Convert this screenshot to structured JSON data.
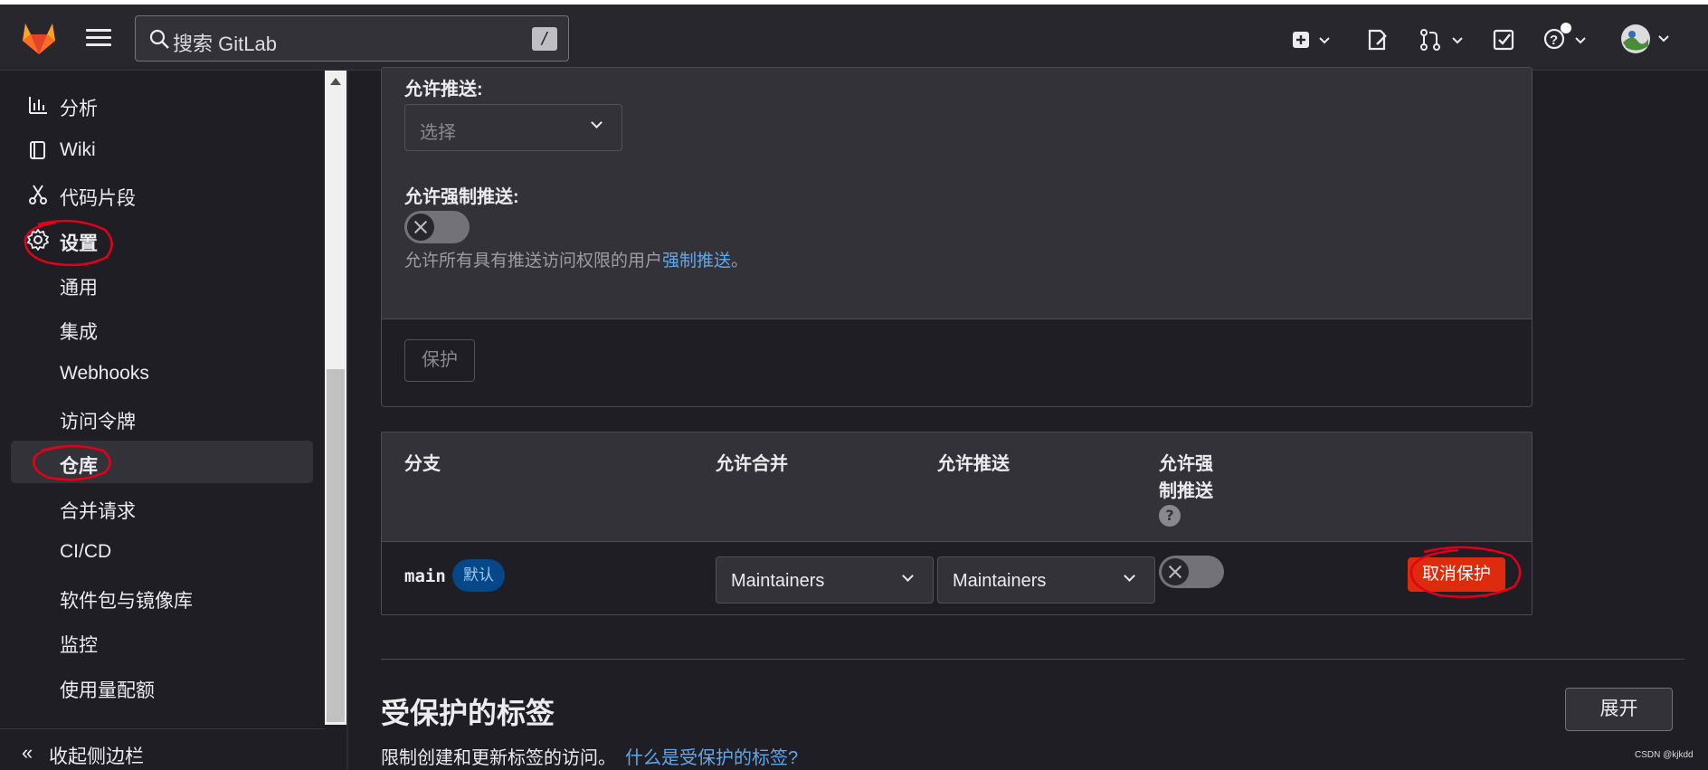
{
  "topbar": {
    "search_placeholder": "搜索 GitLab",
    "search_shortcut": "/"
  },
  "sidebar": {
    "items": [
      {
        "label": "分析",
        "icon": "chart-icon"
      },
      {
        "label": "Wiki",
        "icon": "book-icon"
      },
      {
        "label": "代码片段",
        "icon": "scissors-icon"
      },
      {
        "label": "设置",
        "icon": "gear-icon"
      }
    ],
    "sub_items": [
      {
        "label": "通用"
      },
      {
        "label": "集成"
      },
      {
        "label": "Webhooks"
      },
      {
        "label": "访问令牌"
      },
      {
        "label": "仓库"
      },
      {
        "label": "合并请求"
      },
      {
        "label": "CI/CD"
      },
      {
        "label": "软件包与镜像库"
      },
      {
        "label": "监控"
      },
      {
        "label": "使用量配额"
      }
    ],
    "active_item": "仓库",
    "collapse_label": "收起侧边栏",
    "collapse_icon": "«"
  },
  "form": {
    "allow_push_label": "允许推送:",
    "allow_push_select": "选择",
    "allow_force_push_label": "允许强制推送:",
    "help_text_prefix": "允许所有具有推送访问权限的用户",
    "help_text_link": "强制推送",
    "help_text_suffix": "。",
    "protect_button": "保护",
    "force_push_enabled": false
  },
  "table": {
    "headers": {
      "branch": "分支",
      "allow_merge": "允许合并",
      "allow_push": "允许推送",
      "allow_force_push_line1": "允许强",
      "allow_force_push_line2": "制推送",
      "help_icon": "?"
    },
    "rows": [
      {
        "branch": "main",
        "badge": "默认",
        "allow_merge": "Maintainers",
        "allow_push": "Maintainers",
        "force_push_enabled": false,
        "unprotect_button": "取消保护"
      }
    ]
  },
  "protected_tags": {
    "title": "受保护的标签",
    "description": "限制创建和更新标签的访问。",
    "link": "什么是受保护的标签?",
    "expand_button": "展开"
  },
  "watermark": "CSDN @kjkdd",
  "colors": {
    "accent_link": "#63a6e9",
    "danger": "#dd2b0e",
    "annotation": "#e2001a",
    "badge_bg": "#064787"
  }
}
